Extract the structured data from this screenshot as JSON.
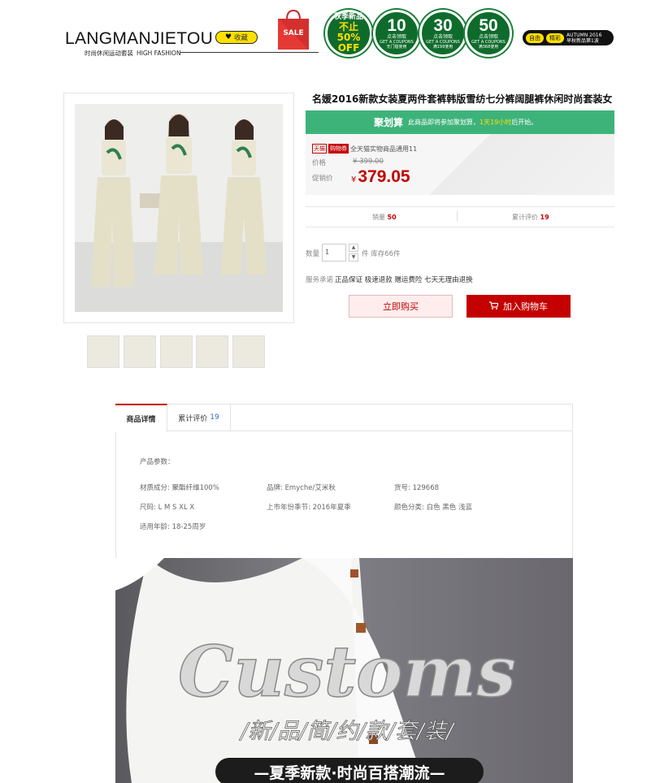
{
  "header": {
    "logo": "LANGMANJIETOU",
    "tagline_cn": "时尚休闲运动套装",
    "tagline_en": "HIGH FASHION",
    "favorite_label": "收藏",
    "sale_bag_label": "SALE",
    "badges": [
      {
        "line1": "秋季新品",
        "line2": "不止50%",
        "line3": "OFF"
      },
      {
        "big": "10",
        "line1": "点击领取",
        "line2": "GET A COUPONS",
        "line3": "无门槛使用"
      },
      {
        "big": "30",
        "line1": "点击领取",
        "line2": "GET A COUPONS",
        "line3": "满199使用"
      },
      {
        "big": "50",
        "line1": "点击领取",
        "line2": "GET A COUPONS",
        "line3": "满368使用"
      }
    ],
    "promo_pill": {
      "left": "自由",
      "mid": "精彩",
      "right1": "AUTUMN 2016",
      "right2": "早秋新品第1波"
    }
  },
  "product": {
    "title": "名媛2016新款女装夏两件套裤韩版雪纺七分裤阔腿裤休闲时尚套装女",
    "jhs": {
      "brand": "聚划算",
      "text1": "此商品即将参加聚划算，",
      "highlight": "1天19小时",
      "text2": "后开始。"
    },
    "promo_tags": {
      "tmall": "天猫",
      "shopping": "购物券",
      "text": "全天猫实物商品通用11"
    },
    "price_label": "价格",
    "original_price": "¥ 399.00",
    "promo_label": "促销价",
    "currency": "¥",
    "promo_price": "379.05",
    "sales_label": "销量",
    "sales_value": "50",
    "reviews_label": "累计评价",
    "reviews_value": "19",
    "qty_label": "数量",
    "qty_value": "1",
    "stock_text": "件 库存66件",
    "service_label": "服务承诺",
    "services": "正品保证 极速退款 赠运费险 七天无理由退换",
    "buy_now": "立即购买",
    "add_cart": "加入购物车"
  },
  "detail": {
    "tab_detail": "商品详情",
    "tab_reviews": "累计评价",
    "tab_reviews_count": "19",
    "params_title": "产品参数：",
    "params": [
      "材质成分: 聚酯纤维100%",
      "品牌: Emyche/艾米秋",
      "货号: 129668",
      "尺码: L M S XL X",
      "上市年份季节: 2016年夏季",
      "颜色分类: 白色 黑色 浅蓝",
      "适用年龄: 18-25周岁"
    ],
    "banner_script": "Customs",
    "banner_line": "/新/品/简/约/款/套/装/",
    "banner_bottom": "—夏季新款·时尚百搭潮流—"
  },
  "colors": {
    "accent_red": "#c40000",
    "jhs_green": "#3db37a",
    "badge_green": "#0f6b2c",
    "yellow": "#ffe000"
  }
}
